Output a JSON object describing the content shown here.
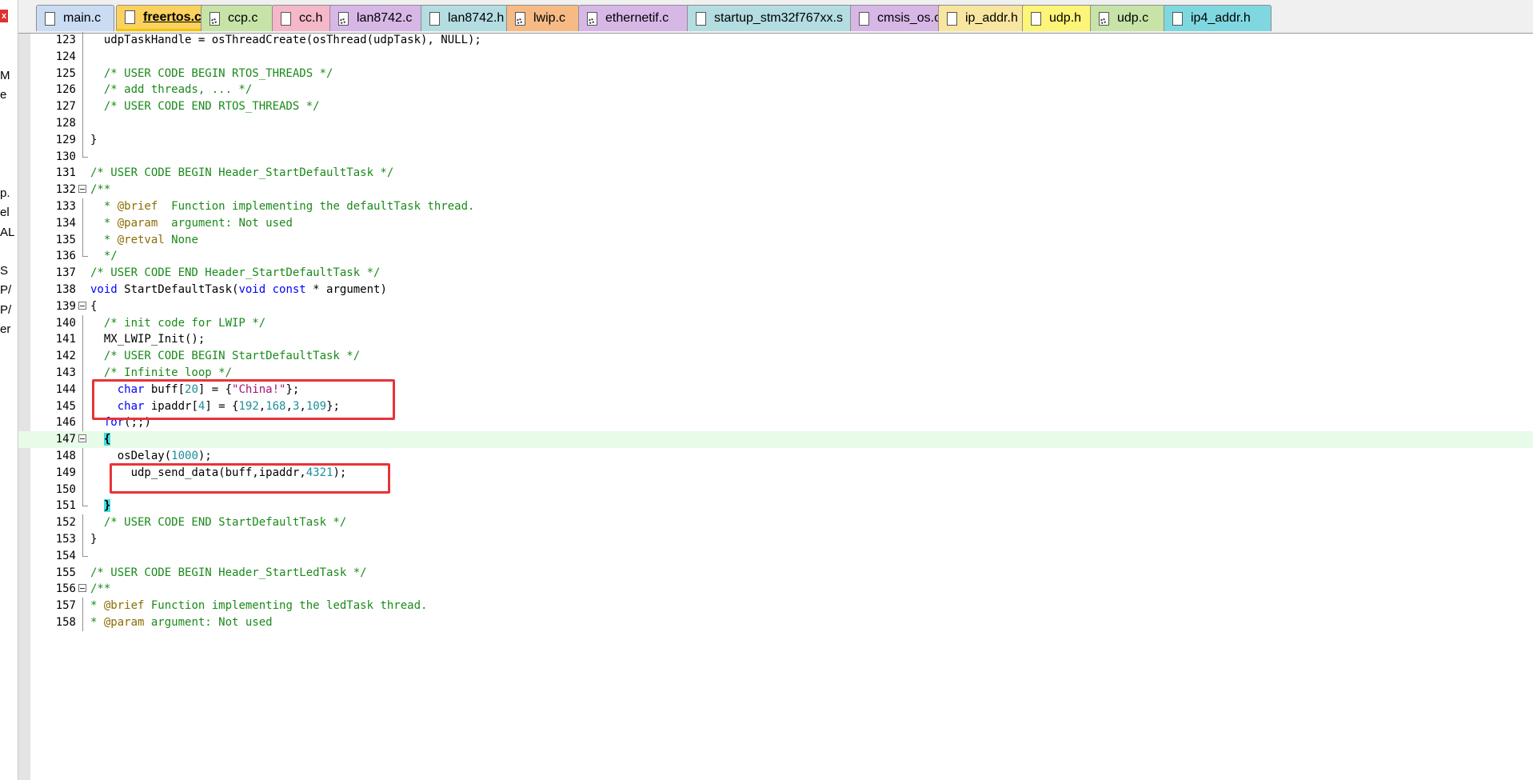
{
  "left_panel": {
    "close_glyph": "x",
    "fragments": [
      "M",
      "e",
      "p.",
      "el",
      "AL",
      "S",
      "P/",
      "P/",
      "er"
    ]
  },
  "tabs": [
    {
      "label": "main.c",
      "color": "#c9dcf4",
      "icon": "file-icon",
      "active": false
    },
    {
      "label": "freertos.c",
      "color": "#fcd25e",
      "icon": "file-icon",
      "active": true
    },
    {
      "label": "ccp.c",
      "color": "#c7e3a8",
      "icon": "generated-file-icon",
      "active": false
    },
    {
      "label": "cc.h",
      "color": "#f5b8c8",
      "icon": "file-icon",
      "active": false
    },
    {
      "label": "lan8742.c",
      "color": "#d7b7e6",
      "icon": "generated-file-icon",
      "active": false
    },
    {
      "label": "lan8742.h",
      "color": "#b3dde0",
      "icon": "file-icon",
      "active": false
    },
    {
      "label": "lwip.c",
      "color": "#f6bb85",
      "icon": "generated-file-icon",
      "active": false
    },
    {
      "label": "ethernetif.c",
      "color": "#d7b7e6",
      "icon": "generated-file-icon",
      "active": false
    },
    {
      "label": "startup_stm32f767xx.s",
      "color": "#b3dde0",
      "icon": "file-icon",
      "active": false
    },
    {
      "label": "cmsis_os.c",
      "color": "#d7b7e6",
      "icon": "file-icon",
      "active": false
    },
    {
      "label": "ip_addr.h",
      "color": "#f8e6a0",
      "icon": "file-icon",
      "active": false
    },
    {
      "label": "udp.h",
      "color": "#fdf577",
      "icon": "file-icon",
      "active": false
    },
    {
      "label": "udp.c",
      "color": "#c7e3a8",
      "icon": "generated-file-icon",
      "active": false
    },
    {
      "label": "ip4_addr.h",
      "color": "#7fd8e0",
      "icon": "file-icon",
      "active": false
    }
  ],
  "code_lines": [
    {
      "num": "123",
      "fold": "line",
      "tokens": [
        [
          "  udpTaskHandle = osThreadCreate(osThread(udpTask), NULL);",
          ""
        ]
      ]
    },
    {
      "num": "124",
      "fold": "line",
      "tokens": []
    },
    {
      "num": "125",
      "fold": "line",
      "tokens": [
        [
          "  /* USER CODE BEGIN RTOS_THREADS */",
          "cm"
        ]
      ]
    },
    {
      "num": "126",
      "fold": "line",
      "tokens": [
        [
          "  /* add threads, ... */",
          "cm"
        ]
      ]
    },
    {
      "num": "127",
      "fold": "line",
      "tokens": [
        [
          "  /* USER CODE END RTOS_THREADS */",
          "cm"
        ]
      ]
    },
    {
      "num": "128",
      "fold": "line",
      "tokens": []
    },
    {
      "num": "129",
      "fold": "line",
      "tokens": [
        [
          "}",
          ""
        ]
      ]
    },
    {
      "num": "130",
      "fold": "end",
      "tokens": []
    },
    {
      "num": "131",
      "fold": "",
      "tokens": [
        [
          "/* USER CODE BEGIN Header_StartDefaultTask */",
          "cm"
        ]
      ]
    },
    {
      "num": "132",
      "fold": "box",
      "tokens": [
        [
          "/**",
          "cm"
        ]
      ]
    },
    {
      "num": "133",
      "fold": "line",
      "tokens": [
        [
          "  * ",
          "cm"
        ],
        [
          "@brief",
          "tag"
        ],
        [
          "  Function implementing the defaultTask thread.",
          "cm"
        ]
      ]
    },
    {
      "num": "134",
      "fold": "line",
      "tokens": [
        [
          "  * ",
          "cm"
        ],
        [
          "@param",
          "tag"
        ],
        [
          "  argument: Not used",
          "cm"
        ]
      ]
    },
    {
      "num": "135",
      "fold": "line",
      "tokens": [
        [
          "  * ",
          "cm"
        ],
        [
          "@retval",
          "tag"
        ],
        [
          " None",
          "cm"
        ]
      ]
    },
    {
      "num": "136",
      "fold": "end",
      "tokens": [
        [
          "  */",
          "cm"
        ]
      ]
    },
    {
      "num": "137",
      "fold": "",
      "tokens": [
        [
          "/* USER CODE END Header_StartDefaultTask */",
          "cm"
        ]
      ]
    },
    {
      "num": "138",
      "fold": "",
      "tokens": [
        [
          "void",
          "kw"
        ],
        [
          " StartDefaultTask(",
          ""
        ],
        [
          "void",
          "kw"
        ],
        [
          " ",
          ""
        ],
        [
          "const",
          "kw"
        ],
        [
          " * argument)",
          ""
        ]
      ]
    },
    {
      "num": "139",
      "fold": "box",
      "tokens": [
        [
          "{",
          ""
        ]
      ]
    },
    {
      "num": "140",
      "fold": "line",
      "tokens": [
        [
          "  /* init code for LWIP */",
          "cm"
        ]
      ]
    },
    {
      "num": "141",
      "fold": "line",
      "tokens": [
        [
          "  MX_LWIP_Init();",
          ""
        ]
      ]
    },
    {
      "num": "142",
      "fold": "line",
      "tokens": [
        [
          "  /* USER CODE BEGIN StartDefaultTask */",
          "cm"
        ]
      ]
    },
    {
      "num": "143",
      "fold": "line",
      "tokens": [
        [
          "  /* Infinite loop */",
          "cm"
        ]
      ]
    },
    {
      "num": "144",
      "fold": "line",
      "tokens": [
        [
          "    ",
          ""
        ],
        [
          "char",
          "kw"
        ],
        [
          " buff[",
          ""
        ],
        [
          "20",
          "num"
        ],
        [
          "] = {",
          ""
        ],
        [
          "\"China!\"",
          "str"
        ],
        [
          "};",
          ""
        ]
      ]
    },
    {
      "num": "145",
      "fold": "line",
      "tokens": [
        [
          "    ",
          ""
        ],
        [
          "char",
          "kw"
        ],
        [
          " ipaddr[",
          ""
        ],
        [
          "4",
          "num"
        ],
        [
          "] = {",
          ""
        ],
        [
          "192",
          "num"
        ],
        [
          ",",
          ""
        ],
        [
          "168",
          "num"
        ],
        [
          ",",
          ""
        ],
        [
          "3",
          "num"
        ],
        [
          ",",
          ""
        ],
        [
          "109",
          "num"
        ],
        [
          "};",
          ""
        ]
      ]
    },
    {
      "num": "146",
      "fold": "line",
      "tokens": [
        [
          "  ",
          ""
        ],
        [
          "for",
          "kw"
        ],
        [
          "(;;)",
          ""
        ]
      ]
    },
    {
      "num": "147",
      "fold": "box",
      "hl": true,
      "tokens": [
        [
          "  ",
          ""
        ],
        [
          "{",
          "br"
        ]
      ]
    },
    {
      "num": "148",
      "fold": "line",
      "tokens": [
        [
          "    osDelay(",
          ""
        ],
        [
          "1000",
          "num"
        ],
        [
          ");",
          ""
        ]
      ]
    },
    {
      "num": "149",
      "fold": "line",
      "tokens": [
        [
          "      udp_send_data(buff,ipaddr,",
          ""
        ],
        [
          "4321",
          "num"
        ],
        [
          ");",
          ""
        ]
      ]
    },
    {
      "num": "150",
      "fold": "line",
      "tokens": []
    },
    {
      "num": "151",
      "fold": "end",
      "tokens": [
        [
          "  ",
          ""
        ],
        [
          "}",
          "br"
        ]
      ]
    },
    {
      "num": "152",
      "fold": "line",
      "tokens": [
        [
          "  /* USER CODE END StartDefaultTask */",
          "cm"
        ]
      ]
    },
    {
      "num": "153",
      "fold": "line",
      "tokens": [
        [
          "}",
          ""
        ]
      ]
    },
    {
      "num": "154",
      "fold": "end",
      "tokens": []
    },
    {
      "num": "155",
      "fold": "",
      "tokens": [
        [
          "/* USER CODE BEGIN Header_StartLedTask */",
          "cm"
        ]
      ]
    },
    {
      "num": "156",
      "fold": "box",
      "tokens": [
        [
          "/**",
          "cm"
        ]
      ]
    },
    {
      "num": "157",
      "fold": "line",
      "tokens": [
        [
          "* ",
          "cm"
        ],
        [
          "@brief",
          "tag"
        ],
        [
          " Function implementing the ledTask thread.",
          "cm"
        ]
      ]
    },
    {
      "num": "158",
      "fold": "line",
      "tokens": [
        [
          "* ",
          "cm"
        ],
        [
          "@param",
          "tag"
        ],
        [
          " argument: Not used",
          "cm"
        ]
      ]
    }
  ],
  "colors": {
    "comment": "#1a8a1a",
    "keyword": "#0000ff",
    "number": "#1b8f9a",
    "string": "#a31575",
    "current_line": "#e8fbe8",
    "annotation_box": "#e8333a"
  }
}
